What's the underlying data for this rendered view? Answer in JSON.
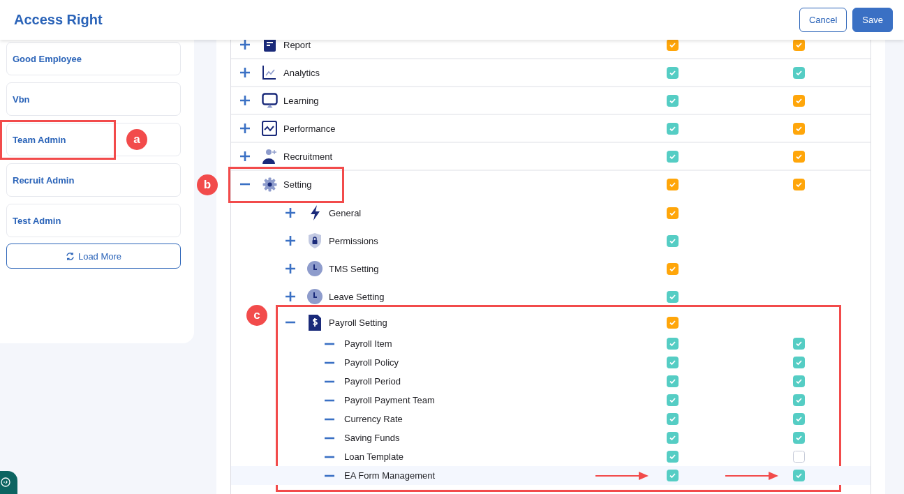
{
  "header": {
    "title": "Access Right",
    "buttons": [
      {
        "label": "Cancel",
        "kind": "secondary"
      },
      {
        "label": "Save",
        "kind": "primary"
      }
    ]
  },
  "sidebar": {
    "roles": [
      {
        "label": "Good Employee"
      },
      {
        "label": "Vbn"
      },
      {
        "label": "Team Admin",
        "annotation": "a"
      },
      {
        "label": "Recruit Admin"
      },
      {
        "label": "Test Admin"
      }
    ],
    "load_more": "Load More"
  },
  "tree": {
    "items": [
      {
        "label": "Report",
        "expanded": false,
        "checks": [
          {
            "checked": true,
            "partial": true
          },
          {
            "checked": true,
            "partial": true
          }
        ]
      },
      {
        "label": "Analytics",
        "expanded": false,
        "checks": [
          {
            "checked": true,
            "partial": false
          },
          {
            "checked": true,
            "partial": false
          }
        ]
      },
      {
        "label": "Learning",
        "expanded": false,
        "checks": [
          {
            "checked": true,
            "partial": false
          },
          {
            "checked": true,
            "partial": true
          }
        ]
      },
      {
        "label": "Performance",
        "expanded": false,
        "checks": [
          {
            "checked": true,
            "partial": false
          },
          {
            "checked": true,
            "partial": true
          }
        ]
      },
      {
        "label": "Recruitment",
        "expanded": false,
        "checks": [
          {
            "checked": true,
            "partial": false
          },
          {
            "checked": true,
            "partial": true
          }
        ]
      },
      {
        "label": "Setting",
        "expanded": true,
        "annotation": "b",
        "checks": [
          {
            "checked": true,
            "partial": true
          },
          {
            "checked": true,
            "partial": true
          }
        ],
        "children": [
          {
            "label": "General",
            "expanded": false,
            "checks": [
              {
                "checked": true,
                "partial": true
              }
            ]
          },
          {
            "label": "Permissions",
            "expanded": false,
            "checks": [
              {
                "checked": true,
                "partial": false
              }
            ]
          },
          {
            "label": "TMS Setting",
            "expanded": false,
            "checks": [
              {
                "checked": true,
                "partial": true
              }
            ]
          },
          {
            "label": "Leave Setting",
            "expanded": false,
            "checks": [
              {
                "checked": true,
                "partial": false
              }
            ]
          },
          {
            "label": "Payroll Setting",
            "expanded": true,
            "annotation": "c",
            "checks": [
              {
                "checked": true,
                "partial": true
              }
            ],
            "children": [
              {
                "label": "Payroll Item",
                "highlighted": false,
                "pointed": false,
                "checks": [
                  {
                    "checked": true,
                    "partial": false
                  },
                  {
                    "checked": true,
                    "partial": false
                  }
                ]
              },
              {
                "label": "Payroll Policy",
                "highlighted": false,
                "pointed": false,
                "checks": [
                  {
                    "checked": true,
                    "partial": false
                  },
                  {
                    "checked": true,
                    "partial": false
                  }
                ]
              },
              {
                "label": "Payroll Period",
                "highlighted": false,
                "pointed": false,
                "checks": [
                  {
                    "checked": true,
                    "partial": false
                  },
                  {
                    "checked": true,
                    "partial": false
                  }
                ]
              },
              {
                "label": "Payroll Payment Team",
                "highlighted": false,
                "pointed": false,
                "checks": [
                  {
                    "checked": true,
                    "partial": false
                  },
                  {
                    "checked": true,
                    "partial": false
                  }
                ]
              },
              {
                "label": "Currency Rate",
                "highlighted": false,
                "pointed": false,
                "checks": [
                  {
                    "checked": true,
                    "partial": false
                  },
                  {
                    "checked": true,
                    "partial": false
                  }
                ]
              },
              {
                "label": "Saving Funds",
                "highlighted": false,
                "pointed": false,
                "checks": [
                  {
                    "checked": true,
                    "partial": false
                  },
                  {
                    "checked": true,
                    "partial": false
                  }
                ]
              },
              {
                "label": "Loan Template",
                "highlighted": false,
                "pointed": false,
                "checks": [
                  {
                    "checked": true,
                    "partial": false
                  },
                  {
                    "checked": false,
                    "partial": false
                  }
                ]
              },
              {
                "label": "EA Form Management",
                "highlighted": true,
                "pointed": true,
                "checks": [
                  {
                    "checked": true,
                    "partial": false
                  },
                  {
                    "checked": true,
                    "partial": false
                  }
                ]
              }
            ]
          }
        ]
      }
    ]
  }
}
